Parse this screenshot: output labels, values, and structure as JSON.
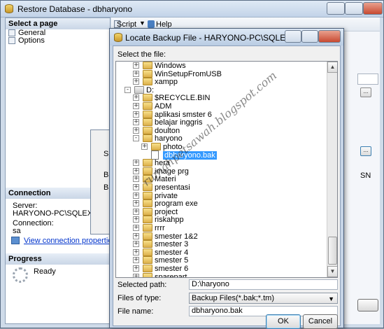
{
  "outer": {
    "title": "Restore Database - dbharyono",
    "select_page": "Select a page",
    "pages": [
      "General",
      "Options"
    ],
    "toolbar": {
      "script": "Script",
      "help": "Help"
    },
    "connection_header": "Connection",
    "server_label": "Server:",
    "server_value": "HARYONO-PC\\SQLEXPRESS",
    "connection_label": "Connection:",
    "connection_value": "sa",
    "view_link": "View connection properties",
    "progress_header": "Progress",
    "progress_status": "Ready",
    "bg_fragments": {
      "sp": "Sp",
      "ba1": "Ba",
      "ba2": "Ba",
      "sn": "SN"
    }
  },
  "dialog": {
    "title": "Locate Backup File - HARYONO-PC\\SQLEXPRESS",
    "select_file": "Select the file:",
    "tree": [
      {
        "label": "Windows",
        "level": 1,
        "exp": "+",
        "type": "folder"
      },
      {
        "label": "WinSetupFromUSB",
        "level": 1,
        "exp": "+",
        "type": "folder"
      },
      {
        "label": "xampp",
        "level": 1,
        "exp": "+",
        "type": "folder"
      },
      {
        "label": "D:",
        "level": 0,
        "exp": "-",
        "type": "drive"
      },
      {
        "label": "$RECYCLE.BIN",
        "level": 1,
        "exp": "+",
        "type": "folder"
      },
      {
        "label": "ADM",
        "level": 1,
        "exp": "+",
        "type": "folder"
      },
      {
        "label": "aplikasi smster 6",
        "level": 1,
        "exp": "+",
        "type": "folder"
      },
      {
        "label": "belajar inggris",
        "level": 1,
        "exp": "+",
        "type": "folder"
      },
      {
        "label": "doulton",
        "level": 1,
        "exp": "+",
        "type": "folder"
      },
      {
        "label": "haryono",
        "level": 1,
        "exp": "-",
        "type": "folder"
      },
      {
        "label": "photo",
        "level": 2,
        "exp": "+",
        "type": "folder"
      },
      {
        "label": "dbharyono.bak",
        "level": 2,
        "exp": "",
        "type": "file",
        "selected": true
      },
      {
        "label": "hera",
        "level": 1,
        "exp": "+",
        "type": "folder"
      },
      {
        "label": "image prg",
        "level": 1,
        "exp": "+",
        "type": "folder"
      },
      {
        "label": "Materi",
        "level": 1,
        "exp": "+",
        "type": "folder"
      },
      {
        "label": "presentasi",
        "level": 1,
        "exp": "+",
        "type": "folder"
      },
      {
        "label": "private",
        "level": 1,
        "exp": "+",
        "type": "folder"
      },
      {
        "label": "program exe",
        "level": 1,
        "exp": "+",
        "type": "folder"
      },
      {
        "label": "project",
        "level": 1,
        "exp": "+",
        "type": "folder"
      },
      {
        "label": "riskahpp",
        "level": 1,
        "exp": "+",
        "type": "folder"
      },
      {
        "label": "rrrr",
        "level": 1,
        "exp": "+",
        "type": "folder"
      },
      {
        "label": "smester 1&2",
        "level": 1,
        "exp": "+",
        "type": "folder"
      },
      {
        "label": "smester 3",
        "level": 1,
        "exp": "+",
        "type": "folder"
      },
      {
        "label": "smester 4",
        "level": 1,
        "exp": "+",
        "type": "folder"
      },
      {
        "label": "smester 5",
        "level": 1,
        "exp": "+",
        "type": "folder"
      },
      {
        "label": "smester 6",
        "level": 1,
        "exp": "+",
        "type": "folder"
      },
      {
        "label": "sparepart",
        "level": 1,
        "exp": "+",
        "type": "folder"
      }
    ],
    "selected_path_label": "Selected path:",
    "selected_path_value": "D:\\haryono",
    "files_of_type_label": "Files of type:",
    "files_of_type_value": "Backup Files(*.bak;*.tm)",
    "file_name_label": "File name:",
    "file_name_value": "dbharyono.bak",
    "ok": "OK",
    "cancel": "Cancel"
  },
  "watermark": "rumahpetsawah.blogspot.com"
}
